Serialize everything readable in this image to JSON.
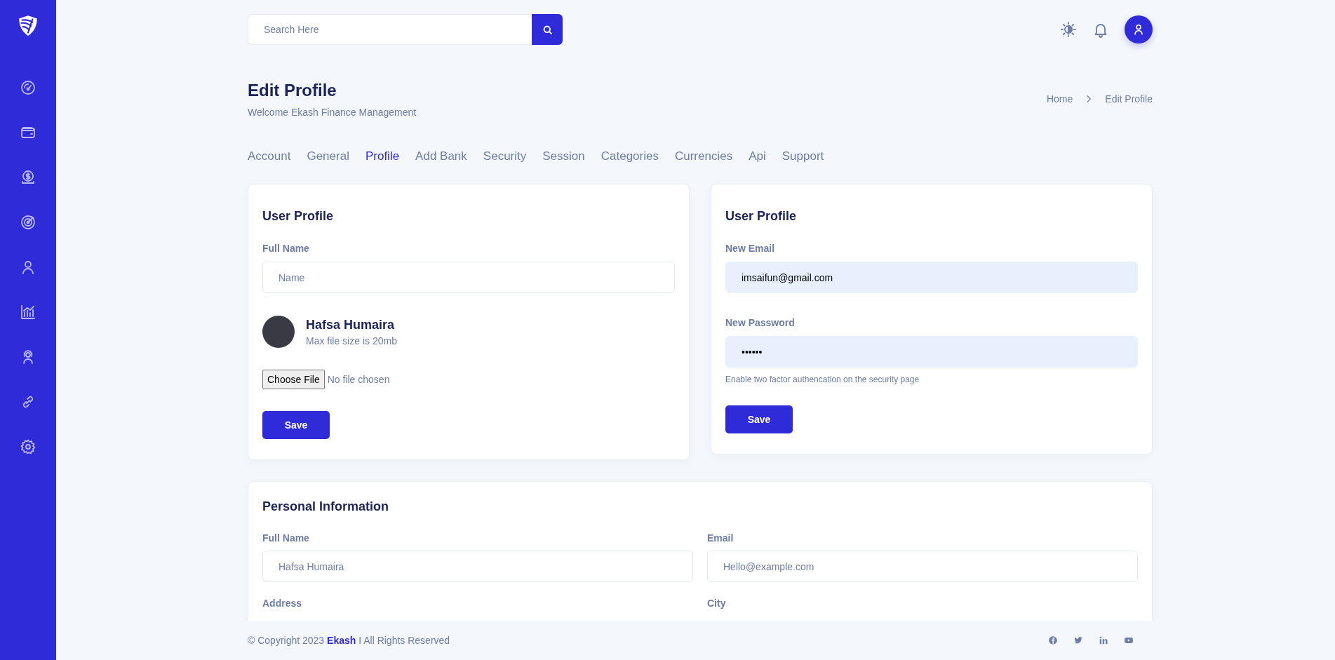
{
  "search": {
    "placeholder": "Search Here"
  },
  "page": {
    "title": "Edit Profile",
    "subtitle": "Welcome Ekash Finance Management"
  },
  "breadcrumb": [
    "Home",
    "Edit Profile"
  ],
  "tabs": [
    {
      "label": "Account",
      "selected": false
    },
    {
      "label": "General",
      "selected": false
    },
    {
      "label": "Profile",
      "selected": true
    },
    {
      "label": "Add Bank",
      "selected": false
    },
    {
      "label": "Security",
      "selected": false
    },
    {
      "label": "Session",
      "selected": false
    },
    {
      "label": "Categories",
      "selected": false
    },
    {
      "label": "Currencies",
      "selected": false
    },
    {
      "label": "Api",
      "selected": false
    },
    {
      "label": "Support",
      "selected": false
    }
  ],
  "user_profile": {
    "title": "User Profile",
    "full_name": {
      "label": "Full Name",
      "placeholder": "Name"
    },
    "name": "Hafsa Humaira",
    "file_note": "Max file size is 20mb",
    "file_button": "Choose File",
    "file_status": "No file chosen",
    "save": "Save"
  },
  "account_card": {
    "title": "User Profile",
    "email": {
      "label": "New Email",
      "value": "imsaifun@gmail.com"
    },
    "password": {
      "label": "New Password",
      "value": "••••••"
    },
    "hint": "Enable two factor authencation on the security page",
    "save": "Save"
  },
  "personal_information": {
    "title": "Personal Information",
    "fields": [
      {
        "label": "Full Name",
        "placeholder": "Hafsa Humaira"
      },
      {
        "label": "Email",
        "placeholder": "Hello@example.com"
      },
      {
        "label": "Address"
      },
      {
        "label": "City"
      }
    ]
  },
  "footer": {
    "copyright": "© Copyright 2023 **Ekash** I All Rights Reserved"
  }
}
